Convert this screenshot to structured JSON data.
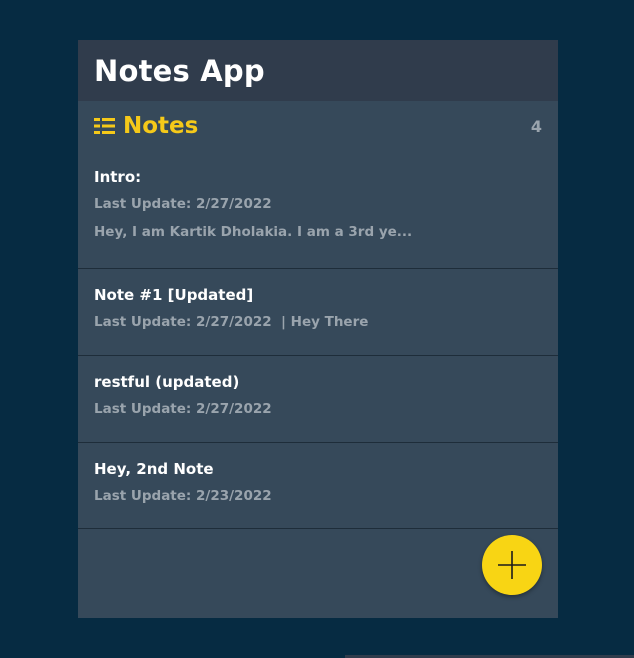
{
  "app": {
    "title": "Notes App"
  },
  "notes_header": {
    "icon": "list-icon",
    "title": "Notes",
    "count": "4"
  },
  "notes": [
    {
      "title": "Intro:",
      "meta": "Last Update: 2/27/2022",
      "preview": "Hey, I am Kartik Dholakia. I am a 3rd ye..."
    },
    {
      "title": "Note #1 [Updated]",
      "meta": "Last Update: 2/27/2022  | Hey There"
    },
    {
      "title": "restful (updated)",
      "meta": "Last Update: 2/27/2022"
    },
    {
      "title": "Hey, 2nd Note",
      "meta": "Last Update: 2/23/2022"
    }
  ],
  "fab": {
    "icon": "plus-icon"
  },
  "colors": {
    "page_bg": "#062b42",
    "panel_bg": "#36495a",
    "header_bg": "#303c4c",
    "accent": "#f5c919",
    "fab_bg": "#f8d514",
    "muted_text": "#9aa4ad"
  }
}
